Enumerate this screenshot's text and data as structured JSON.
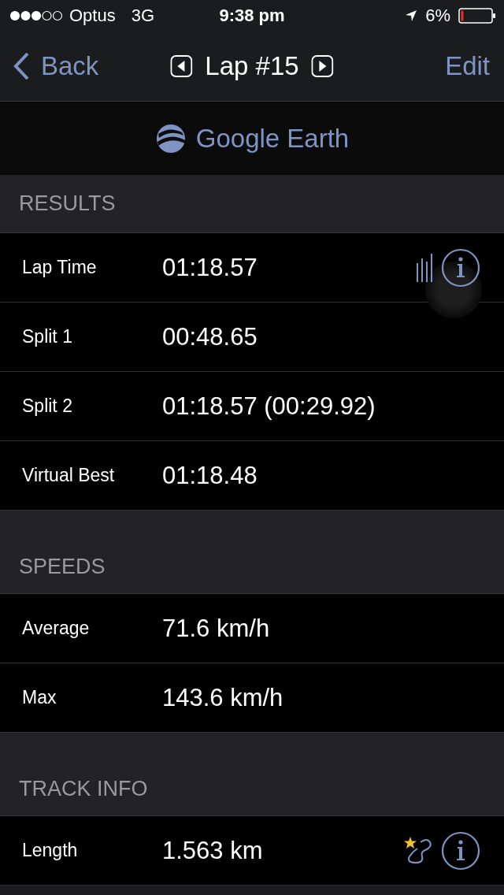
{
  "status_bar": {
    "carrier": "Optus",
    "network": "3G",
    "time": "9:38 pm",
    "battery": "6%"
  },
  "nav": {
    "back": "Back",
    "title": "Lap #15",
    "action": "Edit"
  },
  "source": {
    "label": "Google Earth"
  },
  "sections": [
    {
      "title": "RESULTS",
      "rows": [
        {
          "label": "Lap Time",
          "value": "01:18.57",
          "accessories": [
            {
              "kind": "chart"
            },
            {
              "kind": "info"
            }
          ]
        },
        {
          "label": "Split 1",
          "value": "00:48.65",
          "accessories": []
        },
        {
          "label": "Split 2",
          "value": "01:18.57 (00:29.92)",
          "accessories": []
        },
        {
          "label": "Virtual Best",
          "value": "01:18.48",
          "accessories": []
        }
      ]
    },
    {
      "title": "SPEEDS",
      "rows": [
        {
          "label": "Average",
          "value": "71.6 km/h",
          "accessories": []
        },
        {
          "label": "Max",
          "value": "143.6 km/h",
          "accessories": []
        }
      ]
    },
    {
      "title": "TRACK INFO",
      "rows": [
        {
          "label": "Length",
          "value": "1.563 km",
          "accessories": [
            {
              "kind": "track"
            },
            {
              "kind": "info"
            }
          ]
        }
      ]
    }
  ]
}
